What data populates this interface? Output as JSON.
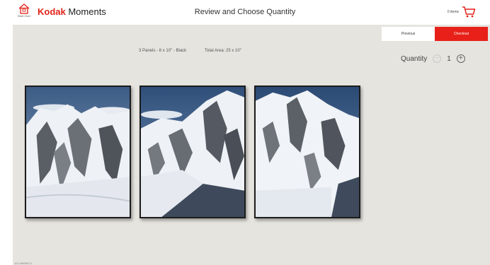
{
  "header": {
    "home_label": "Start Over",
    "logo_brand": "Kodak",
    "logo_rest": " Moments",
    "title": "Review and Choose Quantity",
    "cart_count": "0 items"
  },
  "actions": {
    "previous_label": "Previous",
    "checkout_label": "Checkout"
  },
  "product": {
    "panels_description": "3 Panels - 8 x 10\" - Black",
    "total_area": "Total Area: 25 x 10\""
  },
  "quantity": {
    "label": "Quantity",
    "value": "1",
    "minus_symbol": "−",
    "plus_symbol": "+"
  },
  "footer": {
    "note": "102.4MBM2.0"
  },
  "colors": {
    "brand_red": "#e2231a",
    "checkout_red": "#e8201a",
    "background": "#e6e4df",
    "frame": "#1c1c1c"
  },
  "icons": {
    "home": "home-icon",
    "cart": "cart-icon"
  }
}
